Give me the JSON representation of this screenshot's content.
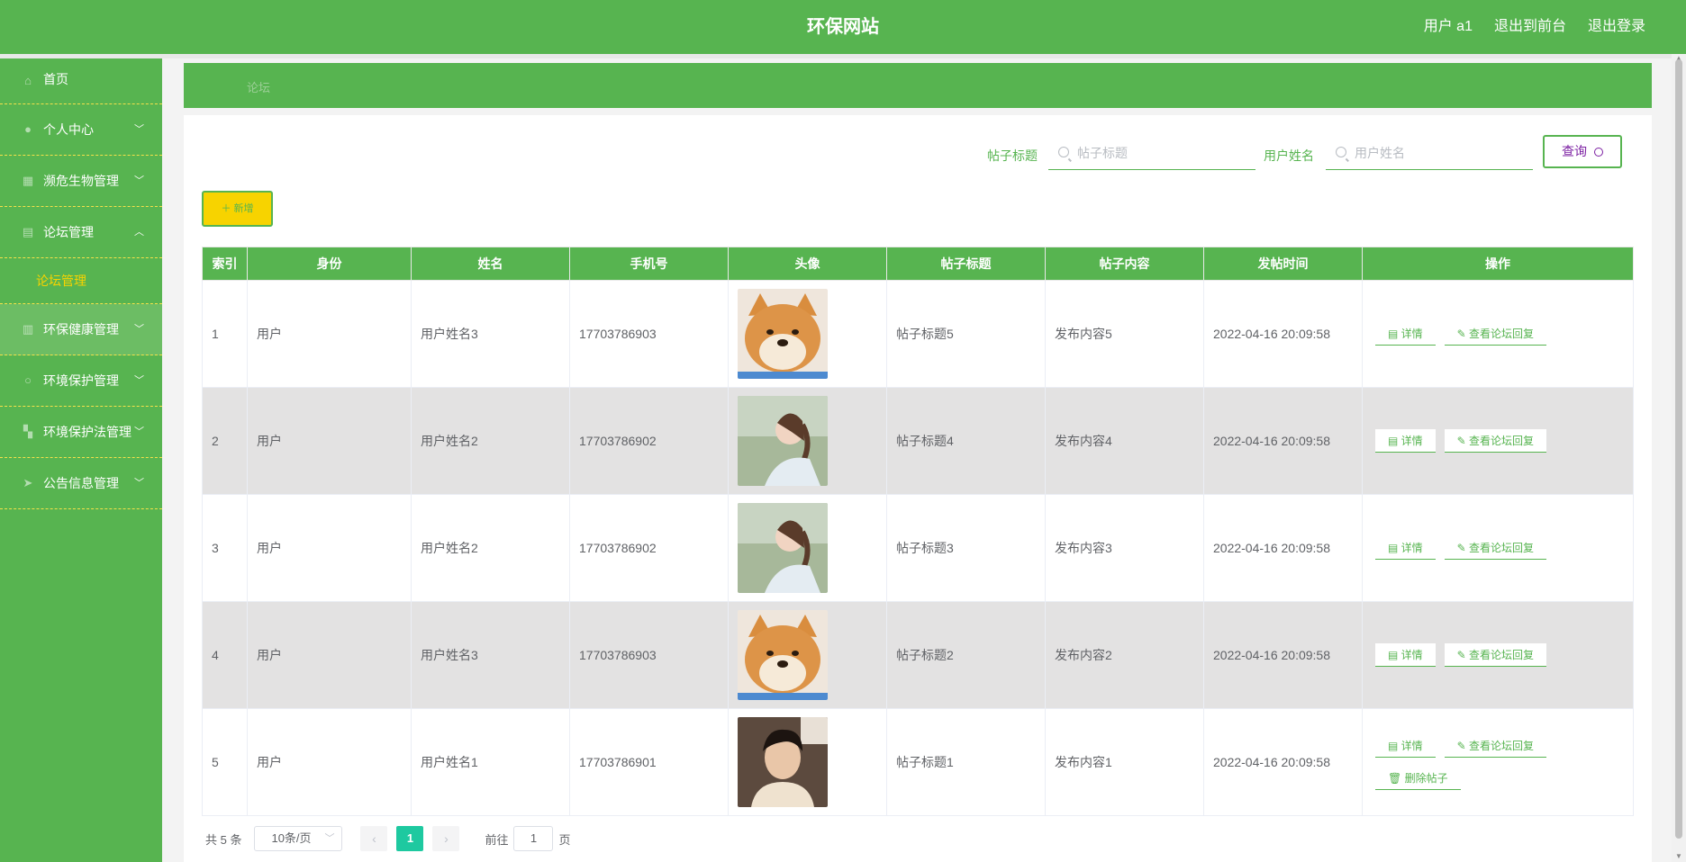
{
  "header": {
    "title": "环保网站",
    "user": "用户 a1",
    "back_to_front": "退出到前台",
    "logout": "退出登录"
  },
  "sidebar": {
    "items": [
      {
        "label": "首页",
        "icon": "home-icon"
      },
      {
        "label": "个人中心",
        "icon": "user-icon"
      },
      {
        "label": "濒危生物管理",
        "icon": "grid-icon"
      },
      {
        "label": "论坛管理",
        "icon": "forum-icon"
      },
      {
        "label": "环保健康管理",
        "icon": "chart-icon"
      },
      {
        "label": "环境保护管理",
        "icon": "circle-icon"
      },
      {
        "label": "环境保护法管理",
        "icon": "apps-icon"
      },
      {
        "label": "公告信息管理",
        "icon": "send-icon"
      }
    ],
    "submenu": {
      "label": "论坛管理"
    }
  },
  "breadcrumb": {
    "current": "论坛"
  },
  "search": {
    "title_label": "帖子标题",
    "title_placeholder": "帖子标题",
    "user_label": "用户姓名",
    "user_placeholder": "用户姓名",
    "query_label": "查询"
  },
  "add_label": "＋ 新增",
  "table": {
    "headers": [
      "索引",
      "身份",
      "姓名",
      "手机号",
      "头像",
      "帖子标题",
      "帖子内容",
      "发帖时间",
      "操作"
    ],
    "rows": [
      {
        "index": "1",
        "role": "用户",
        "name": "用户姓名3",
        "phone": "17703786903",
        "avatar": "shiba-dog",
        "title": "帖子标题5",
        "content": "发布内容5",
        "time": "2022-04-16 20:09:58"
      },
      {
        "index": "2",
        "role": "用户",
        "name": "用户姓名2",
        "phone": "17703786902",
        "avatar": "girl-profile",
        "title": "帖子标题4",
        "content": "发布内容4",
        "time": "2022-04-16 20:09:58"
      },
      {
        "index": "3",
        "role": "用户",
        "name": "用户姓名2",
        "phone": "17703786902",
        "avatar": "girl-profile",
        "title": "帖子标题3",
        "content": "发布内容3",
        "time": "2022-04-16 20:09:58"
      },
      {
        "index": "4",
        "role": "用户",
        "name": "用户姓名3",
        "phone": "17703786903",
        "avatar": "shiba-dog",
        "title": "帖子标题2",
        "content": "发布内容2",
        "time": "2022-04-16 20:09:58"
      },
      {
        "index": "5",
        "role": "用户",
        "name": "用户姓名1",
        "phone": "17703786901",
        "avatar": "young-man",
        "title": "帖子标题1",
        "content": "发布内容1",
        "time": "2022-04-16 20:09:58"
      }
    ],
    "actions": {
      "detail": "详情",
      "view_reply": "查看论坛回复",
      "delete": "删除帖子"
    }
  },
  "pagination": {
    "total": "共 5 条",
    "page_size": "10条/页",
    "current_page": "1",
    "goto_label": "前往",
    "goto_value": "1",
    "page_suffix": "页"
  },
  "colors": {
    "primary": "#57b450",
    "accent_yellow": "#f7d300",
    "active_page": "#1ec9a0",
    "query_text": "#7b1fa2"
  }
}
